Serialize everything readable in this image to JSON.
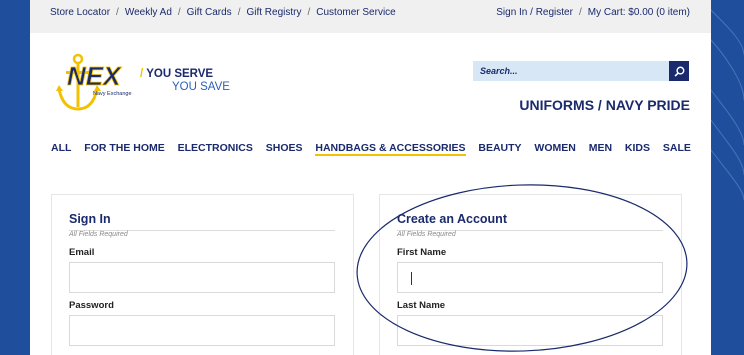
{
  "utility": {
    "left_links": [
      "Store Locator",
      "Weekly Ad",
      "Gift Cards",
      "Gift Registry",
      "Customer Service"
    ],
    "sign_in": "Sign In / Register",
    "cart": "My Cart:  $0.00 (0 item)"
  },
  "logo": {
    "wordmark": "NEX",
    "subtitle": "Navy Exchange",
    "tag_slash": "/",
    "tag_line1": "YOU SERVE",
    "tag_line2": "YOU SAVE"
  },
  "search": {
    "placeholder": "Search...",
    "icon": "search-icon"
  },
  "brand_tagline": "UNIFORMS / NAVY PRIDE",
  "nav": {
    "items": [
      "ALL",
      "FOR THE HOME",
      "ELECTRONICS",
      "SHOES",
      "HANDBAGS & ACCESSORIES",
      "BEAUTY",
      "WOMEN",
      "MEN",
      "KIDS",
      "SALE"
    ],
    "active": "HANDBAGS & ACCESSORIES"
  },
  "sign_in": {
    "title": "Sign In",
    "note": "All Fields Required",
    "email_label": "Email",
    "password_label": "Password"
  },
  "create_account": {
    "title": "Create an Account",
    "note": "All Fields Required",
    "first_name_label": "First Name",
    "last_name_label": "Last Name"
  },
  "colors": {
    "navy": "#1a2a6c",
    "gold": "#f2c200",
    "background_blue": "#1f4f9c",
    "search_field": "#d8e7f6"
  }
}
